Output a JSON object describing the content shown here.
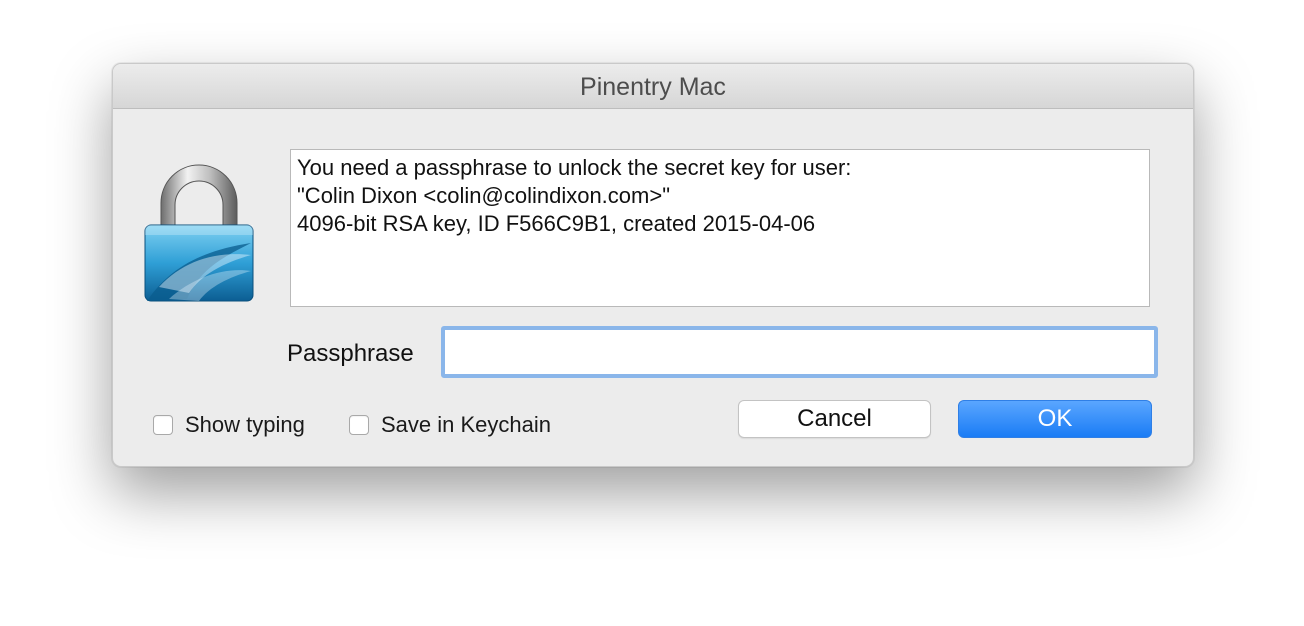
{
  "window": {
    "title": "Pinentry Mac"
  },
  "lock_icon": {
    "name": "gpg-lock-icon"
  },
  "message": {
    "lines": [
      "You need a passphrase to unlock the secret key for user:",
      "\"Colin Dixon <colin@colindixon.com>\"",
      "4096-bit RSA key, ID F566C9B1, created 2015-04-06"
    ]
  },
  "passphrase": {
    "label": "Passphrase",
    "value": ""
  },
  "options": {
    "show_typing": {
      "label": "Show typing",
      "checked": false
    },
    "save_keychain": {
      "label": "Save in Keychain",
      "checked": false
    }
  },
  "buttons": {
    "cancel": "Cancel",
    "ok": "OK"
  },
  "colors": {
    "accent": "#1a7cf5",
    "focus_ring": "#8ab6ea",
    "window_bg": "#ececec"
  }
}
